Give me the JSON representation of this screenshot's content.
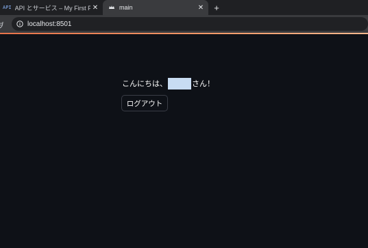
{
  "browser": {
    "tabs": [
      {
        "favicon": "API",
        "title": "API とサービス – My First Proje",
        "close": "✕",
        "active": false
      },
      {
        "favicon": "streamlit-crown-icon",
        "title": "main",
        "close": "✕",
        "active": true
      }
    ],
    "new_tab": "+",
    "toolbar_edge": "ヺ",
    "url": "localhost:8501"
  },
  "colors": {
    "tabstrip_bg": "#1f2023",
    "toolbar_bg": "#3a3b3e",
    "page_bg": "#0e1117",
    "username_highlight": "#c8dcf2"
  },
  "main": {
    "greeting_prefix": "こんにちは、",
    "greeting_suffix": "さん！",
    "logout_label": "ログアウト"
  }
}
